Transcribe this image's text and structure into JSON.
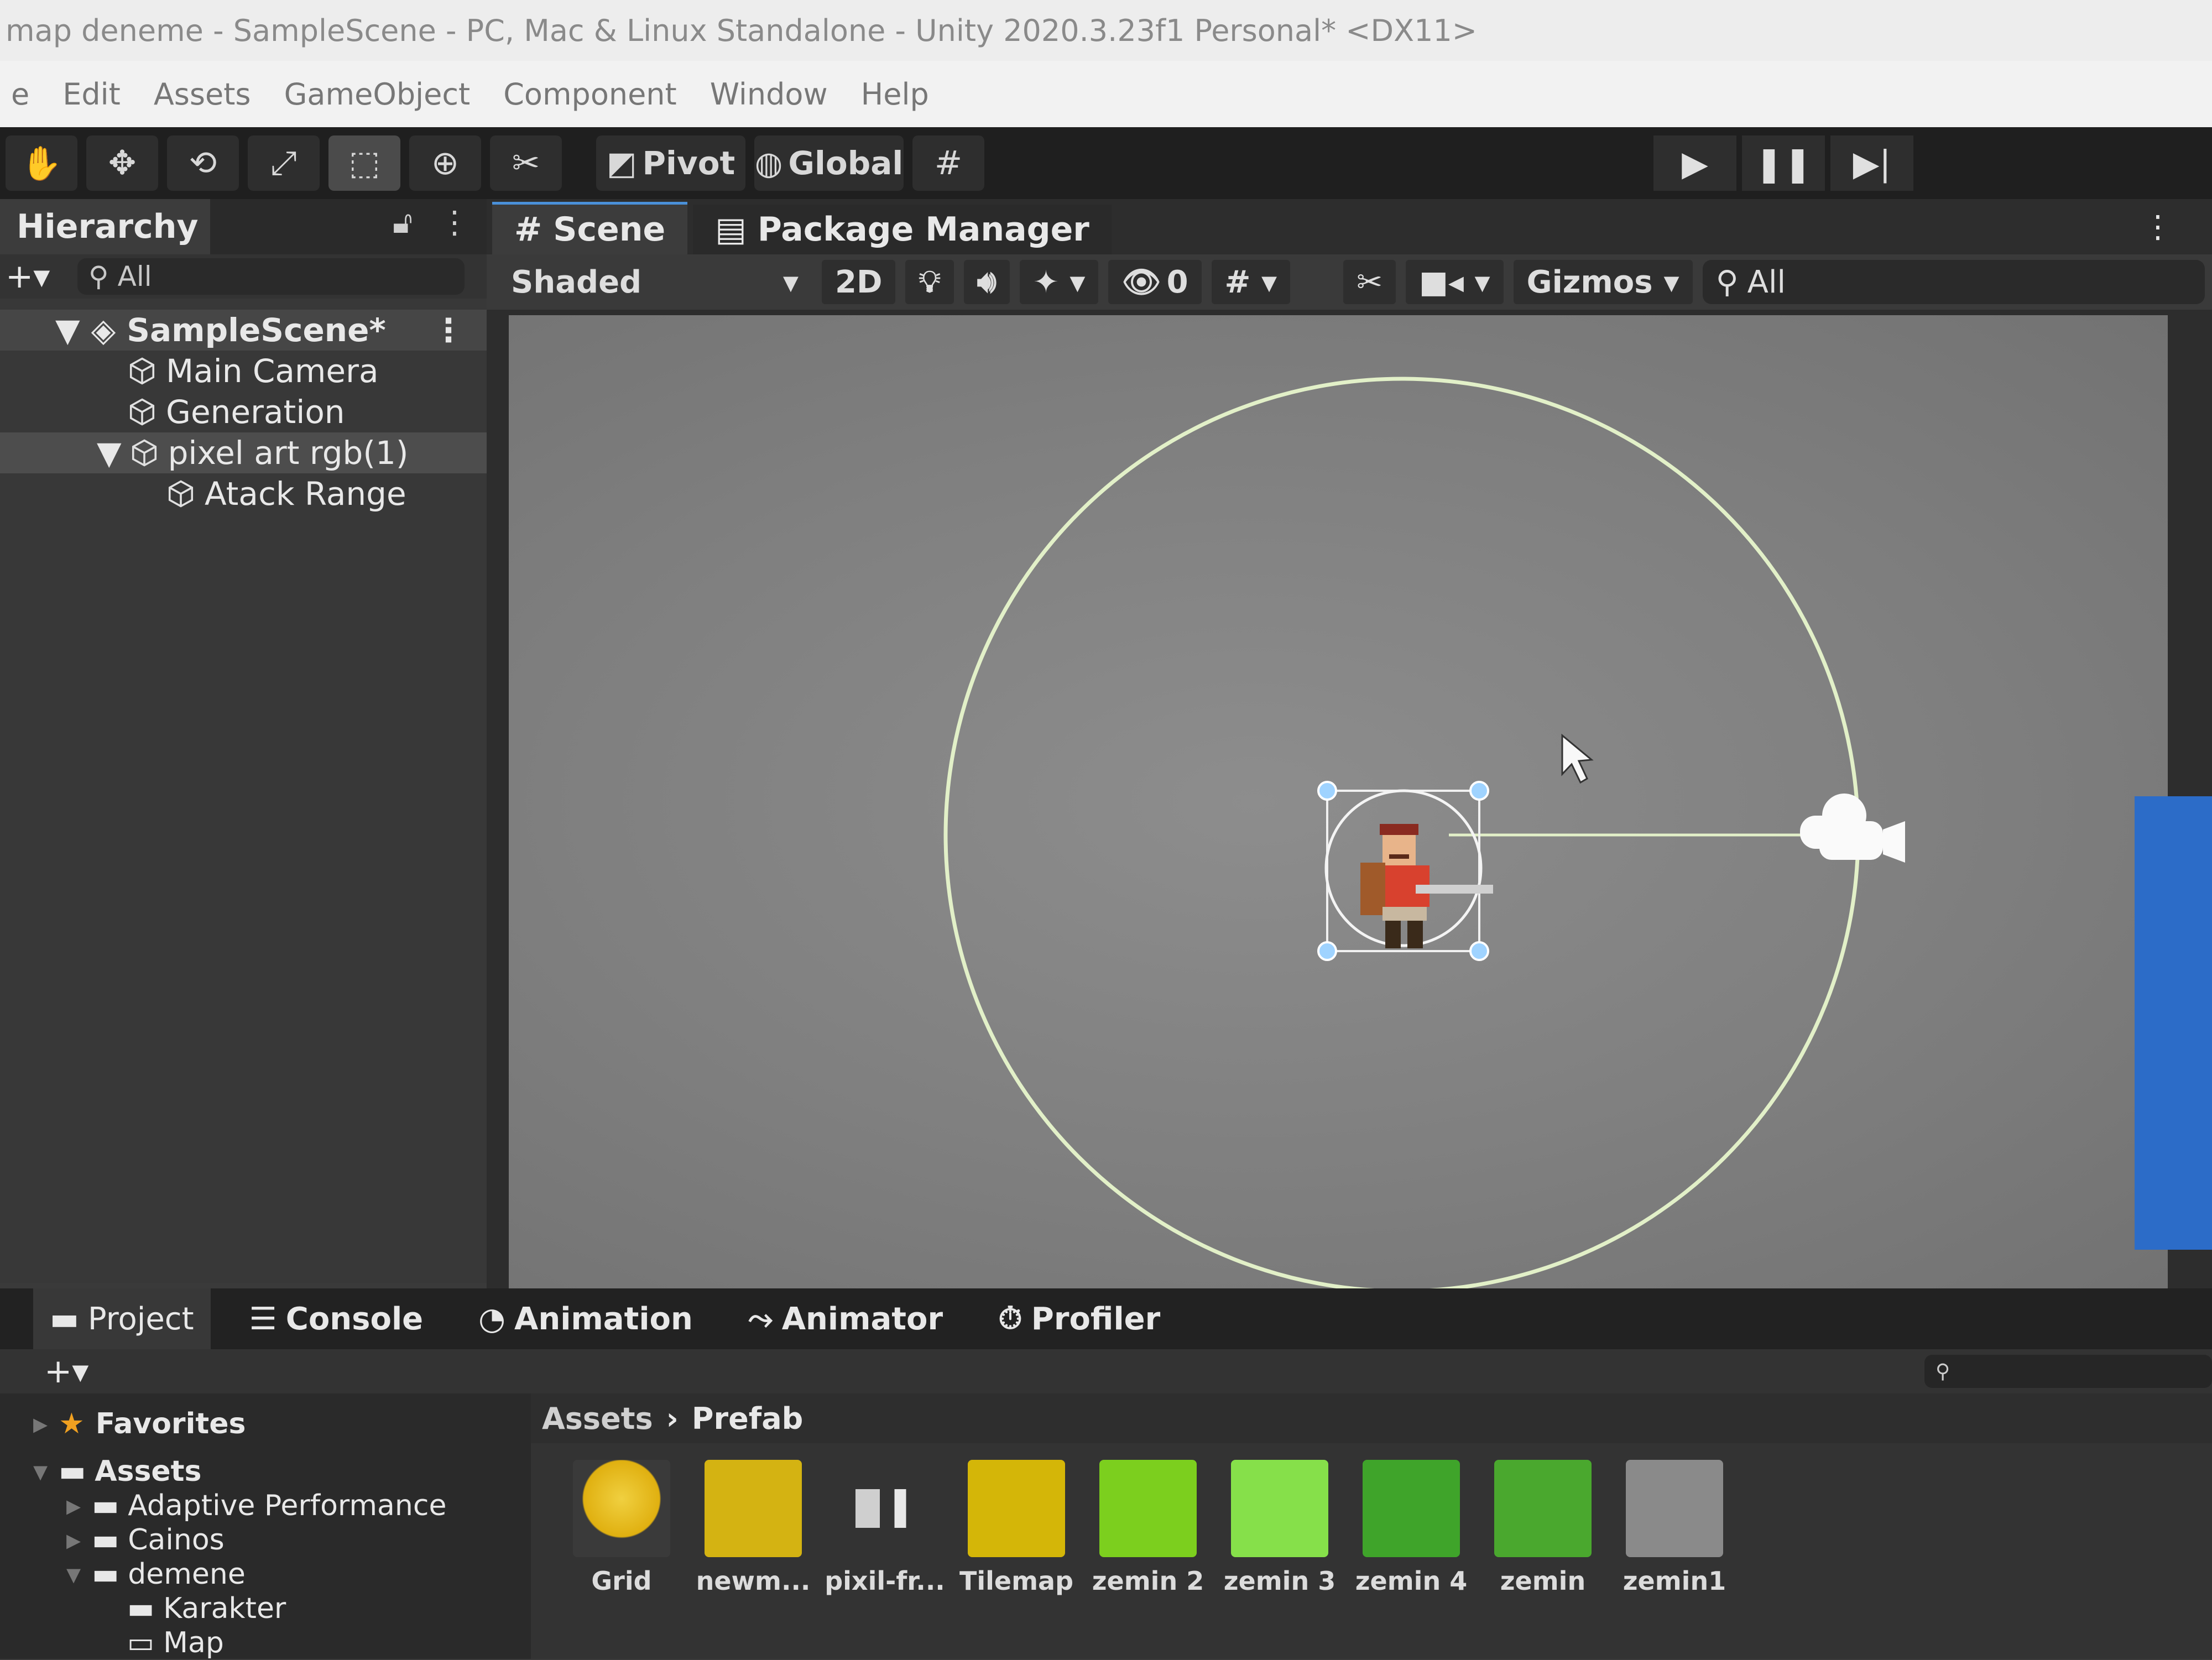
{
  "window": {
    "title": "map deneme - SampleScene - PC, Mac & Linux Standalone - Unity 2020.3.23f1 Personal* <DX11>"
  },
  "menu": [
    "e",
    "Edit",
    "Assets",
    "GameObject",
    "Component",
    "Window",
    "Help"
  ],
  "toolbar": {
    "tools": [
      "hand-tool",
      "move-tool",
      "rotate-tool",
      "scale-tool",
      "rect-tool",
      "transform-tool",
      "custom-tool"
    ],
    "pivot_label": "Pivot",
    "global_label": "Global",
    "play_icons": [
      "play-icon",
      "pause-icon",
      "step-icon"
    ]
  },
  "hierarchy": {
    "title": "Hierarchy",
    "search_placeholder": "All",
    "items": [
      {
        "label": "SampleScene*",
        "depth": 0,
        "type": "scene",
        "expanded": true
      },
      {
        "label": "Main Camera",
        "depth": 1,
        "type": "gameobject"
      },
      {
        "label": "Generation",
        "depth": 1,
        "type": "gameobject"
      },
      {
        "label": "pixel art rgb(1)",
        "depth": 1,
        "type": "gameobject",
        "expanded": true,
        "selected": true
      },
      {
        "label": "Atack Range",
        "depth": 2,
        "type": "gameobject"
      }
    ]
  },
  "scene": {
    "tabs": [
      {
        "label": "Scene",
        "active": true
      },
      {
        "label": "Package Manager",
        "active": false
      }
    ],
    "shading_mode": "Shaded",
    "mode_2d_label": "2D",
    "hidden_count": "0",
    "gizmos_label": "Gizmos",
    "search_placeholder": "All"
  },
  "bottom": {
    "tabs": [
      {
        "label": "Project",
        "active": true,
        "icon": "folder-icon"
      },
      {
        "label": "Console",
        "active": false,
        "icon": "console-icon"
      },
      {
        "label": "Animation",
        "active": false,
        "icon": "clock-icon"
      },
      {
        "label": "Animator",
        "active": false,
        "icon": "animator-icon"
      },
      {
        "label": "Profiler",
        "active": false,
        "icon": "profiler-icon"
      }
    ],
    "favorites_label": "Favorites",
    "tree": [
      {
        "label": "Assets",
        "depth": 0,
        "open": true
      },
      {
        "label": "Adaptive Performance",
        "depth": 1
      },
      {
        "label": "Cainos",
        "depth": 1
      },
      {
        "label": "demene",
        "depth": 1,
        "open": true
      },
      {
        "label": "Karakter",
        "depth": 2
      },
      {
        "label": "Map",
        "depth": 1
      }
    ],
    "breadcrumb": [
      "Assets",
      "Prefab"
    ],
    "assets": [
      {
        "label": "Grid",
        "color": "#e8c020"
      },
      {
        "label": "newm...",
        "color": "#d4b312"
      },
      {
        "label": "pixil-fr...",
        "color": "#cfcfcf"
      },
      {
        "label": "Tilemap",
        "color": "#d4b608"
      },
      {
        "label": "zemin 2",
        "color": "#7ccf1e"
      },
      {
        "label": "zemin 3",
        "color": "#86e04a"
      },
      {
        "label": "zemin 4",
        "color": "#3fa42a"
      },
      {
        "label": "zemin",
        "color": "#4aa82e"
      },
      {
        "label": "zemin1",
        "color": "#d0d0d0"
      }
    ]
  },
  "colors": {
    "range_circle": "#e2f0c8",
    "selection_handle": "#9fd3ff",
    "accent_blue": "#2c6cc8"
  }
}
